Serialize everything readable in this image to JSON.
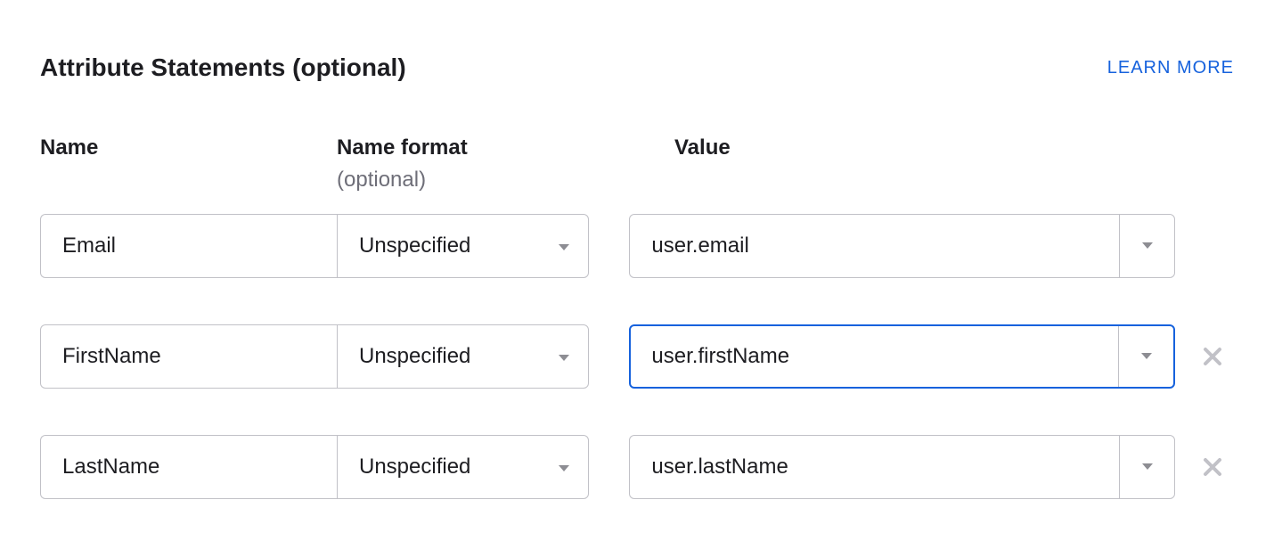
{
  "header": {
    "title": "Attribute Statements (optional)",
    "learn_more": "LEARN MORE"
  },
  "columns": {
    "name": "Name",
    "format": "Name format",
    "format_sub": "(optional)",
    "value": "Value"
  },
  "rows": [
    {
      "name": "Email",
      "format": "Unspecified",
      "value": "user.email",
      "removable": false,
      "focused": false
    },
    {
      "name": "FirstName",
      "format": "Unspecified",
      "value": "user.firstName",
      "removable": true,
      "focused": true
    },
    {
      "name": "LastName",
      "format": "Unspecified",
      "value": "user.lastName",
      "removable": true,
      "focused": false
    }
  ],
  "colors": {
    "link": "#1662dd",
    "border": "#c1c1c7",
    "muted": "#6e6e78"
  }
}
